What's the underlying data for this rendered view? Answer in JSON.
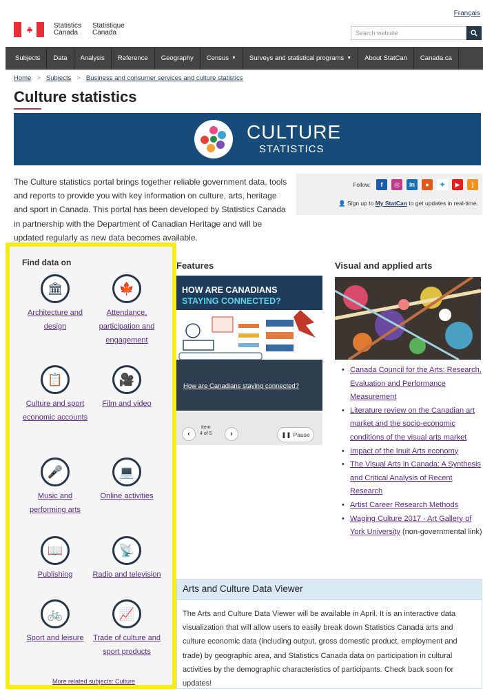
{
  "header": {
    "language_link": "Français",
    "brand_en_1": "Statistics",
    "brand_en_2": "Canada",
    "brand_fr_1": "Statistique",
    "brand_fr_2": "Canada",
    "search_placeholder": "Search website"
  },
  "nav": {
    "items": [
      {
        "label": "Subjects",
        "caret": ""
      },
      {
        "label": "Data",
        "caret": ""
      },
      {
        "label": "Analysis",
        "caret": ""
      },
      {
        "label": "Reference",
        "caret": ""
      },
      {
        "label": "Geography",
        "caret": ""
      },
      {
        "label": "Census",
        "caret": "▼"
      },
      {
        "label": "Surveys and statistical programs",
        "caret": "▼"
      },
      {
        "label": "About StatCan",
        "caret": ""
      },
      {
        "label": "Canada.ca",
        "caret": ""
      }
    ]
  },
  "breadcrumb": {
    "home": "Home",
    "subjects": "Subjects",
    "current": "Business and consumer services and culture statistics"
  },
  "page": {
    "title": "Culture statistics"
  },
  "banner": {
    "word1": "CULTURE",
    "word2": "STATISTICS"
  },
  "intro": {
    "text": "The Culture statistics portal brings together reliable government data, tools and reports to provide you with key information on culture, arts, heritage and sport in Canada. This portal has been developed by Statistics Canada in partnership with the Department of Canadian Heritage and will be updated regularly as new data becomes available."
  },
  "follow": {
    "label": "Follow:",
    "signup_prefix": "Sign up to ",
    "signup_link": "My StatCan",
    "signup_suffix": " to get updates in real-time."
  },
  "sidebar": {
    "title": "Find data on",
    "subjects": [
      {
        "label": "Architecture and design",
        "icon": "museum-icon"
      },
      {
        "label": "Attendance, participation and engagement",
        "icon": "maple-leaf-icon"
      },
      {
        "label": "Culture and sport economic accounts",
        "icon": "accounts-icon"
      },
      {
        "label": "Film and video",
        "icon": "film-camera-icon"
      },
      {
        "label": "Music and performing arts",
        "icon": "performer-icon"
      },
      {
        "label": "Online activities",
        "icon": "screen-icon"
      },
      {
        "label": "Publishing",
        "icon": "book-icon"
      },
      {
        "label": "Radio and television",
        "icon": "antenna-icon"
      },
      {
        "label": "Sport and leisure",
        "icon": "cyclist-icon"
      },
      {
        "label": "Trade of culture and sport products",
        "icon": "trade-chart-icon"
      }
    ],
    "more_link": "More related subjects: Culture"
  },
  "features": {
    "title": "Features",
    "headline_1": "HOW ARE CANADIANS",
    "headline_2": "STAYING CONNECTED?",
    "caption": "How are Canadians staying connected?",
    "item_label": "Item",
    "item_count": "4 of 5",
    "pause_label": "Pause"
  },
  "visual_arts": {
    "title": "Visual and applied arts",
    "links": [
      {
        "text": "Canada Council for the Arts: Research, Evaluation and Performance Measurement",
        "suffix": ""
      },
      {
        "text": "Literature review on the Canadian art market and the socio-economic conditions of the visual arts market",
        "suffix": ""
      },
      {
        "text": "Impact of the Inuit Arts economy",
        "suffix": ""
      },
      {
        "text": "The Visual Arts in Canada: A Synthesis and Critical Analysis of Recent Research",
        "suffix": ""
      },
      {
        "text": "Artist Career Research Methods",
        "suffix": ""
      },
      {
        "text": "Waging Culture 2017 - Art Gallery of York University",
        "suffix": " (non-governmental link)"
      }
    ]
  },
  "viewer": {
    "title": "Arts and Culture Data Viewer",
    "text": "The Arts and Culture Data Viewer will be available in April. It is an interactive data visualization that will allow users to easily break down Statistics Canada arts and culture economic data (including output, gross domestic product, employment and trade) by geographic area, and Statistics Canada data on participation in cultural activities by the demographic characteristics of participants. Check back soon for updates!"
  },
  "colors": {
    "nav_bg": "#444444",
    "banner_bg": "#174b7a",
    "highlight_border": "#f5ea1a",
    "link_visited": "#5a2a8a",
    "flag_red": "#eb2d37"
  }
}
